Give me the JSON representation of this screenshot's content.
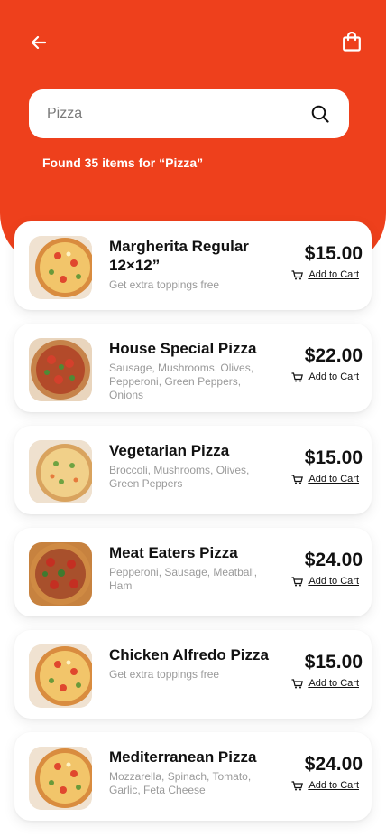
{
  "header": {
    "back_icon": "arrow-left-icon",
    "bag_icon": "shopping-bag-icon",
    "color": "#EE401C"
  },
  "search": {
    "value": "",
    "placeholder": "Pizza",
    "icon": "search-icon"
  },
  "results_text": "Found 35 items for “Pizza”",
  "add_to_cart_label": "Add to Cart",
  "items": [
    {
      "name": "Margherita Regular 12×12”",
      "desc": "Get extra toppings free",
      "price": "$15.00"
    },
    {
      "name": "House Special Pizza",
      "desc": "Sausage, Mushrooms, Olives, Pepperoni, Green Peppers, Onions",
      "price": "$22.00"
    },
    {
      "name": "Vegetarian Pizza",
      "desc": "Broccoli, Mushrooms, Olives, Green Peppers",
      "price": "$15.00"
    },
    {
      "name": "Meat Eaters Pizza",
      "desc": "Pepperoni, Sausage, Meatball, Ham",
      "price": "$24.00"
    },
    {
      "name": "Chicken Alfredo Pizza",
      "desc": "Get extra toppings free",
      "price": "$15.00"
    },
    {
      "name": "Mediterranean Pizza",
      "desc": "Mozzarella, Spinach, Tomato, Garlic, Feta Cheese",
      "price": "$24.00"
    }
  ]
}
